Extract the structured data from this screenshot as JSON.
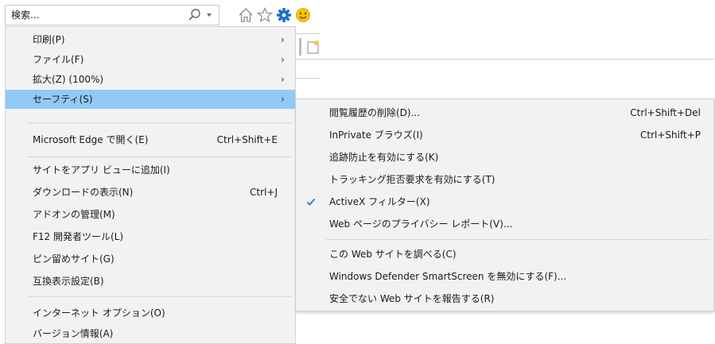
{
  "search": {
    "placeholder": "検索...",
    "button_arrow": "▾"
  },
  "toolbar": {
    "home_icon": "home-icon",
    "favorites_icon": "star-icon",
    "settings_icon": "gear-icon",
    "feedback_icon": "smiley-icon"
  },
  "menu": {
    "items": [
      {
        "label": "印刷(P)",
        "has_submenu": true
      },
      {
        "label": "ファイル(F)",
        "has_submenu": true
      },
      {
        "label": "拡大(Z) (100%)",
        "has_submenu": true
      },
      {
        "label": "セーフティ(S)",
        "has_submenu": true,
        "active": true
      },
      {
        "label": "Microsoft Edge で開く(E)",
        "shortcut": "Ctrl+Shift+E"
      },
      {
        "label": "サイトをアプリ ビューに追加(I)"
      },
      {
        "label": "ダウンロードの表示(N)",
        "shortcut": "Ctrl+J"
      },
      {
        "label": "アドオンの管理(M)"
      },
      {
        "label": "F12 開発者ツール(L)"
      },
      {
        "label": "ピン留めサイト(G)"
      },
      {
        "label": "互換表示設定(B)"
      },
      {
        "label": "インターネット オプション(O)"
      },
      {
        "label": "バージョン情報(A)"
      }
    ],
    "arrow": "›"
  },
  "submenu": {
    "items": [
      {
        "label": "閲覧履歴の削除(D)...",
        "shortcut": "Ctrl+Shift+Del"
      },
      {
        "label": "InPrivate ブラウズ(I)",
        "shortcut": "Ctrl+Shift+P"
      },
      {
        "label": "追跡防止を有効にする(K)"
      },
      {
        "label": "トラッキング拒否要求を有効にする(T)"
      },
      {
        "label": "ActiveX フィルター(X)",
        "checked": true
      },
      {
        "label": "Web ページのプライバシー レポート(V)..."
      },
      {
        "label": "この Web サイトを調べる(C)"
      },
      {
        "label": "Windows Defender SmartScreen を無効にする(F)..."
      },
      {
        "label": "安全でない Web サイトを報告する(R)"
      }
    ]
  },
  "colors": {
    "menu_bg": "#f2f2f2",
    "highlight": "#91c9f7",
    "gear": "#1a6fc4",
    "smiley": "#f6c400",
    "check": "#2a7ad2"
  }
}
